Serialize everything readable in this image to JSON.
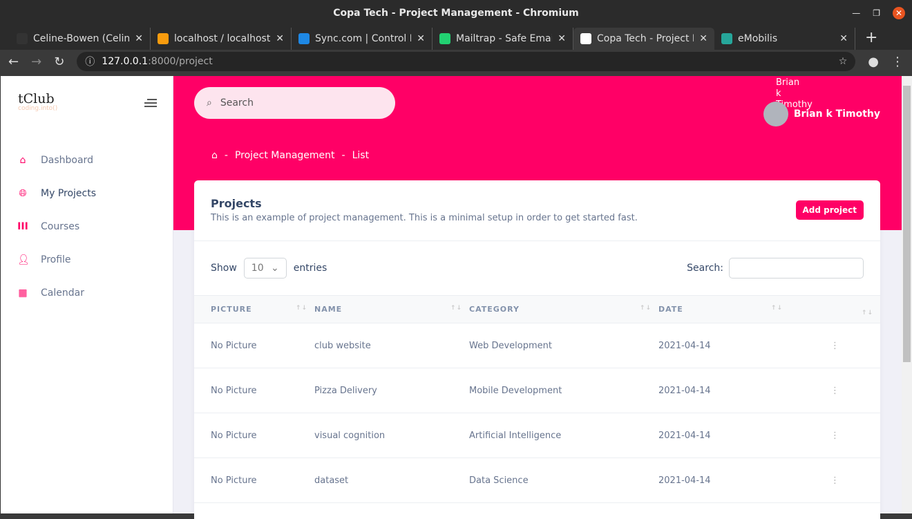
{
  "window": {
    "title": "Copa Tech - Project Management - Chromium"
  },
  "tabs": [
    {
      "label": "Celine-Bowen (Celine",
      "icon": "github-icon",
      "color": "#333"
    },
    {
      "label": "localhost / localhost",
      "icon": "phpmyadmin-icon",
      "color": "#f89c0e"
    },
    {
      "label": "Sync.com | Control P",
      "icon": "sync-icon",
      "color": "#1e88e5"
    },
    {
      "label": "Mailtrap - Safe Email",
      "icon": "mailtrap-icon",
      "color": "#22d172"
    },
    {
      "label": "Copa Tech - Project M",
      "icon": "tclub-icon",
      "color": "#fff"
    },
    {
      "label": "eMobilis",
      "icon": "emobilis-icon",
      "color": "#26a69a"
    }
  ],
  "address": {
    "host": "127.0.0.1",
    "path": ":8000/project"
  },
  "sidebar": {
    "logo": "tClub",
    "tagline": "coding.into()",
    "items": [
      {
        "label": "Dashboard"
      },
      {
        "label": "My Projects"
      },
      {
        "label": "Courses"
      },
      {
        "label": "Profile"
      },
      {
        "label": "Calendar"
      }
    ]
  },
  "header": {
    "search_placeholder": "Search",
    "user_name": "Brian k Timothy",
    "avatar_alt": "Brian k Timothy",
    "breadcrumb": [
      "Project Management",
      "List"
    ]
  },
  "card": {
    "title": "Projects",
    "subtitle": "This is an example of project management. This is a minimal setup in order to get started fast.",
    "add_label": "Add project",
    "show_label": "Show",
    "entries_value": "10",
    "entries_label": "entries",
    "search_label": "Search:",
    "columns": [
      "PICTURE",
      "NAME",
      "CATEGORY",
      "DATE"
    ],
    "rows": [
      [
        "No Picture",
        "club website",
        "Web Development",
        "2021-04-14"
      ],
      [
        "No Picture",
        "Pizza Delivery",
        "Mobile Development",
        "2021-04-14"
      ],
      [
        "No Picture",
        "visual cognition",
        "Artificial Intelligence",
        "2021-04-14"
      ],
      [
        "No Picture",
        "dataset",
        "Data Science",
        "2021-04-14"
      ]
    ]
  },
  "colors": {
    "accent": "#ff0066"
  }
}
